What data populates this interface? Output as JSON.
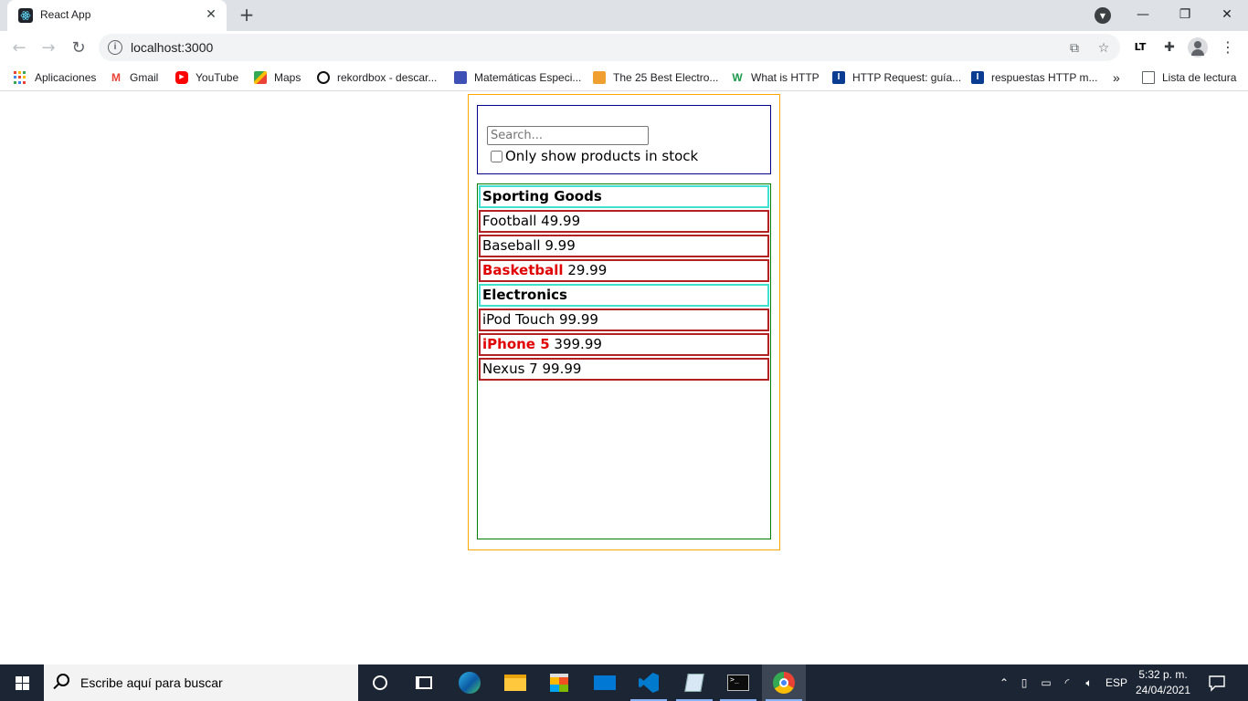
{
  "browser": {
    "tab_title": "React App",
    "url": "localhost:3000",
    "bookmarks": [
      {
        "label": "Aplicaciones",
        "icon": "apps-grid-icon"
      },
      {
        "label": "Gmail",
        "icon": "gmail-icon"
      },
      {
        "label": "YouTube",
        "icon": "youtube-icon"
      },
      {
        "label": "Maps",
        "icon": "maps-icon"
      },
      {
        "label": "rekordbox - descar...",
        "icon": "rekordbox-icon"
      },
      {
        "label": "Matemáticas Especi...",
        "icon": "doc-icon"
      },
      {
        "label": "The 25 Best Electro...",
        "icon": "orange-site-icon"
      },
      {
        "label": "What is HTTP",
        "icon": "w-icon"
      },
      {
        "label": "HTTP Request: guía...",
        "icon": "blue-i-icon"
      },
      {
        "label": "respuestas HTTP m...",
        "icon": "blue-i-icon"
      }
    ],
    "more_bookmarks": "»",
    "reading_list": "Lista de lectura"
  },
  "app": {
    "search": {
      "placeholder": "Search...",
      "value": ""
    },
    "in_stock_label": "Only show products in stock",
    "in_stock_checked": false,
    "rows": [
      {
        "type": "category",
        "name": "Sporting Goods"
      },
      {
        "type": "product",
        "name": "Football",
        "price": "49.99",
        "stocked": true
      },
      {
        "type": "product",
        "name": "Baseball",
        "price": "9.99",
        "stocked": true
      },
      {
        "type": "product",
        "name": "Basketball",
        "price": "29.99",
        "stocked": false
      },
      {
        "type": "category",
        "name": "Electronics"
      },
      {
        "type": "product",
        "name": "iPod Touch",
        "price": "99.99",
        "stocked": true
      },
      {
        "type": "product",
        "name": "iPhone 5",
        "price": "399.99",
        "stocked": false
      },
      {
        "type": "product",
        "name": "Nexus 7",
        "price": "99.99",
        "stocked": true
      }
    ]
  },
  "taskbar": {
    "search_placeholder": "Escribe aquí para buscar",
    "language": "ESP",
    "time": "5:32 p. m.",
    "date": "24/04/2021"
  }
}
